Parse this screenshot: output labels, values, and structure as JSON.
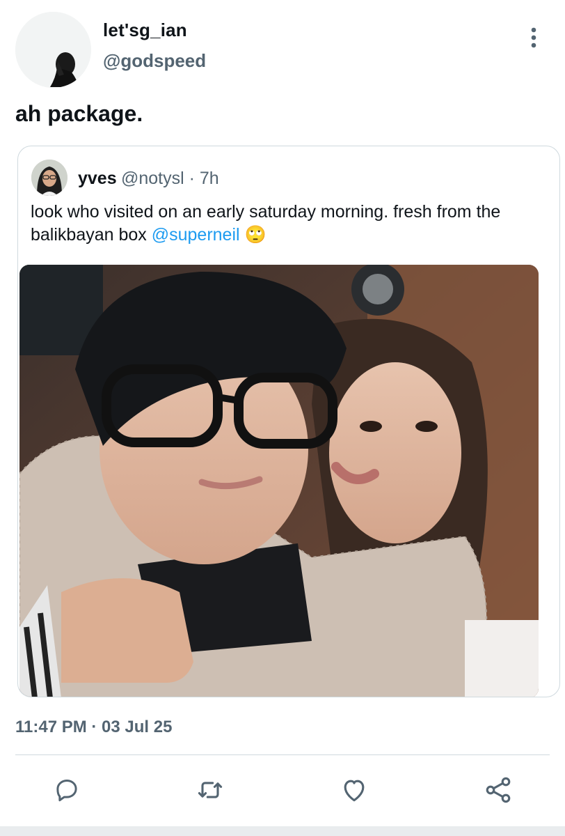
{
  "author": {
    "display_name": "let'sg_ian",
    "handle": "@godspeed"
  },
  "tweet": {
    "text": "ah package.",
    "timestamp": "11:47 PM · 03 Jul 25"
  },
  "quoted": {
    "name": "yves",
    "handle_time": "@notysl · 7h",
    "text_before": "look who visited on an early saturday morning. fresh from the balikbayan box ",
    "mention": "@superneil",
    "emoji": "🙄"
  },
  "actions": [
    "reply-icon",
    "retweet-icon",
    "like-icon",
    "share-icon"
  ],
  "colors": {
    "text_primary": "#0f1419",
    "text_secondary": "#536471",
    "link": "#1d9bf0",
    "border": "#cfd9de"
  }
}
